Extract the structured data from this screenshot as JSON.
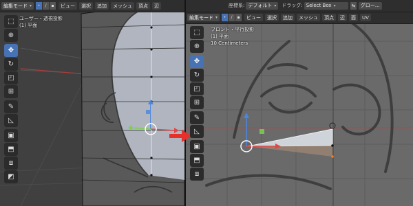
{
  "left_panel": {
    "header": {
      "mode": "編集モード",
      "menus": [
        "ビュー",
        "選択",
        "追加",
        "メッシュ",
        "頂点",
        "辺"
      ]
    },
    "overlay": {
      "view_name": "ユーザー・透視投影",
      "object_name": "(1) 平面"
    }
  },
  "right_panel": {
    "header": {
      "coordinate_label": "座標系:",
      "coordinate_value": "デフォルト",
      "drag_label": "ドラッグ:",
      "drag_value": "Select Box",
      "global_value": "グロー…",
      "mode": "編集モード",
      "menus": [
        "ビュー",
        "選択",
        "追加",
        "メッシュ",
        "頂点",
        "辺",
        "面",
        "UV"
      ]
    },
    "overlay": {
      "view_name": "フロント・平行投影",
      "object_name": "(1) 平面",
      "scale": "10 Centimeters"
    }
  },
  "toolbar_icons": [
    "select-box-icon",
    "cursor-icon",
    "move-icon",
    "rotate-icon",
    "scale-icon",
    "transform-icon",
    "annotate-icon",
    "measure-icon",
    "add-cube-icon",
    "extrude-icon",
    "inset-icon",
    "bevel-icon",
    "loop-cut-icon",
    "knife-icon"
  ],
  "colors": {
    "accent": "#4772b3",
    "x_axis": "#e04848",
    "y_axis": "#7ad14a",
    "z_axis": "#4a86e0",
    "arrow": "#e8302a"
  }
}
